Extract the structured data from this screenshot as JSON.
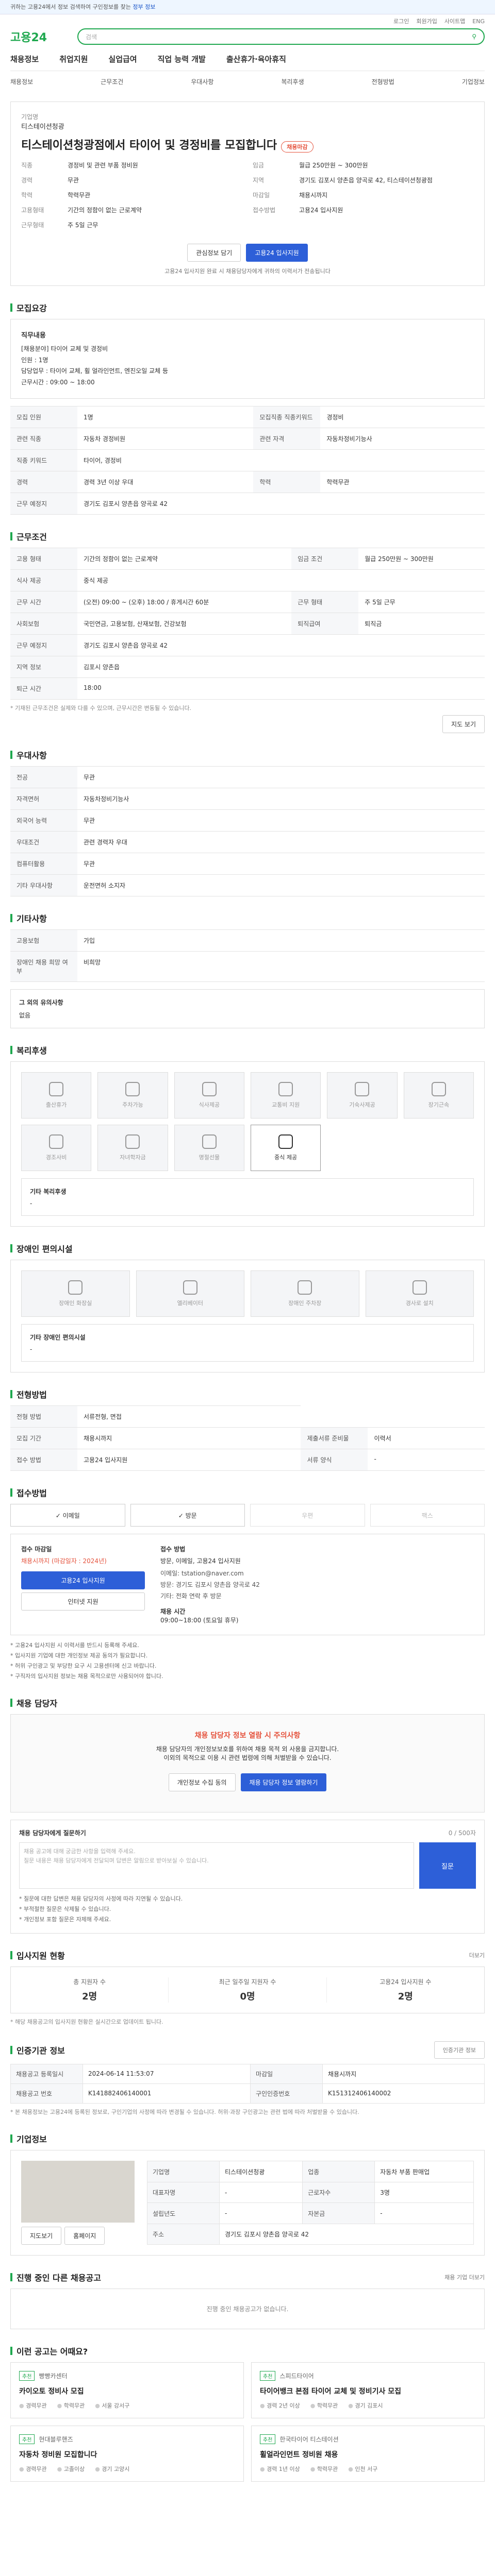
{
  "topbar": {
    "text": "귀하는 고용24에서 정보 검색하여 구인정보를 찾는",
    "link": "정부 정보"
  },
  "header": {
    "logo": "고용24",
    "search_placeholder": "검색",
    "util": [
      "로그인",
      "회원가입",
      "사이트맵",
      "ENG"
    ],
    "nav": [
      "채용정보",
      "취업지원",
      "실업급여",
      "직업 능력 개발",
      "출산휴가·육아휴직"
    ],
    "sub": [
      "채용정보",
      "근무조건",
      "우대사항",
      "복리후생",
      "전형방법",
      "기업정보"
    ]
  },
  "job": {
    "company_label": "기업명",
    "company": "티스테이션청광",
    "title": "티스테이션청광점에서 타이어 및 경정비를 모집합니다",
    "badge": "채용마감",
    "left": [
      [
        "직종",
        "경정비 및 관련 부품 정비원"
      ],
      [
        "경력",
        "무관"
      ],
      [
        "학력",
        "학력무관"
      ],
      [
        "고용형태",
        "기간의 정함이 없는 근로계약"
      ],
      [
        "근무형태",
        "주 5일 근무"
      ]
    ],
    "right": [
      [
        "임금",
        "월급 250만원 ~ 300만원"
      ],
      [
        "지역",
        "경기도 김포시 양촌읍 양곡로 42, 티스테이션청광점"
      ],
      [
        "마감일",
        "채용시까지"
      ],
      [
        "접수방법",
        "고용24 입사지원"
      ]
    ],
    "btn_scrap": "관심정보 담기",
    "btn_apply": "고용24 입사지원",
    "note": "고용24 입사지원 완료 시 채용담당자에게 귀하의 이력서가 전송됩니다"
  },
  "recruit": {
    "title": "모집요강",
    "desc_label": "직무내용",
    "desc": "[채용분야] 타이어 교체 및 경정비\n인원 : 1명\n담당업무 : 타이어 교체, 휠 얼라인먼트, 엔진오일 교체 등\n근무시간 : 09:00 ~ 18:00",
    "rows": [
      [
        "모집 인원",
        "1명",
        "모집직종 직종키워드",
        "경정비"
      ],
      [
        "관련 직종",
        "자동차 경정비원",
        "관련 자격",
        "자동차정비기능사"
      ],
      [
        "직종 키워드",
        "타이어, 경정비",
        "",
        ""
      ],
      [
        "경력",
        "경력 3년 이상 우대",
        "학력",
        "학력무관"
      ],
      [
        "근무 예정지",
        "경기도 김포시 양촌읍 양곡로 42",
        "",
        ""
      ]
    ]
  },
  "condition": {
    "title": "근무조건",
    "rows": [
      [
        "고용 형태",
        "기간의 정함이 없는 근로계약",
        "임금 조건",
        "월급 250만원 ~ 300만원"
      ],
      [
        "식사 제공",
        "중식 제공",
        "",
        ""
      ],
      [
        "근무 시간",
        "(오전) 09:00 ~ (오후) 18:00 / 휴게시간 60분",
        "근무 형태",
        "주 5일 근무"
      ],
      [
        "사회보험",
        "국민연금, 고용보험, 산재보험, 건강보험",
        "퇴직급여",
        "퇴직금"
      ],
      [
        "근무 예정지",
        "경기도 김포시 양촌읍 양곡로 42",
        "",
        ""
      ],
      [
        "지역 정보",
        "김포시 양촌읍",
        "",
        ""
      ],
      [
        "퇴근 시간",
        "18:00",
        "",
        ""
      ]
    ],
    "note": "* 기재된 근무조건은 실제와 다를 수 있으며, 근무시간은 변동될 수 있습니다.",
    "btn_map": "지도 보기"
  },
  "preference": {
    "title": "우대사항",
    "rows": [
      [
        "전공",
        "무관"
      ],
      [
        "자격면허",
        "자동차정비기능사"
      ],
      [
        "외국어 능력",
        "무관"
      ],
      [
        "우대조건",
        "관련 경력자 우대"
      ],
      [
        "컴퓨터활용",
        "무관"
      ],
      [
        "기타 우대사항",
        "운전면허 소지자"
      ]
    ]
  },
  "other": {
    "title": "기타사항",
    "rows": [
      [
        "고용보험",
        "가입"
      ],
      [
        "장애인 채용 희망 여부",
        "비희망"
      ]
    ],
    "extra_label": "그 외의 유의사항",
    "extra": "없음"
  },
  "welfare": {
    "title": "복리후생",
    "tiles": [
      {
        "label": "출산휴가",
        "on": false
      },
      {
        "label": "주차가능",
        "on": false
      },
      {
        "label": "식사제공",
        "on": false
      },
      {
        "label": "교통비 지원",
        "on": false
      },
      {
        "label": "기숙사제공",
        "on": false
      },
      {
        "label": "장기근속",
        "on": false
      },
      {
        "label": "경조사비",
        "on": false
      },
      {
        "label": "자녀학자금",
        "on": false
      },
      {
        "label": "명절선물",
        "on": false
      },
      {
        "label": "중식 제공",
        "on": true
      }
    ],
    "box_title": "기타 복리후생",
    "box_val": "-"
  },
  "disabled": {
    "title": "장애인 편의시설",
    "tiles": [
      "장애인 화장실",
      "엘리베이터",
      "장애인 주차장",
      "경사로 설치"
    ],
    "box_title": "기타 장애인 편의시설",
    "box_val": "-"
  },
  "process": {
    "title": "전형방법",
    "rows": [
      [
        "전형 방법",
        "서류전형, 면접"
      ],
      [
        "모집 기간",
        "채용시까지",
        "제출서류 준비물",
        "이력서"
      ],
      [
        "접수 방법",
        "고용24 입사지원",
        "서류 양식",
        "-"
      ]
    ]
  },
  "apply": {
    "title": "접수방법",
    "methods": [
      {
        "label": "이메일",
        "on": true
      },
      {
        "label": "방문",
        "on": true
      },
      {
        "label": "우편",
        "on": false
      },
      {
        "label": "팩스",
        "on": false
      }
    ],
    "deadline_label": "접수 마감일",
    "deadline": "채용시까지 (마감일자 : 2024년)",
    "btn_apply": "고용24 입사지원",
    "btn_map": "인터넷 지원",
    "dept_label": "접수 방법",
    "dept": "방문, 이메일, 고용24 입사지원",
    "detail": "이메일: tstation@naver.com\n방문: 경기도 김포시 양촌읍 양곡로 42\n기타: 전화 연락 후 방문",
    "hours_label": "채용 시간",
    "hours": "09:00~18:00 (토요일 휴무)",
    "bullets": [
      "* 고용24 입사지원 시 이력서를 반드시 등록해 주세요.",
      "* 입사지원 기업에 대한 개인정보 제공 동의가 필요합니다.",
      "* 허위 구인광고 및 부당한 요구 시 고용센터에 신고 바랍니다.",
      "* 구직자의 입사지원 정보는 채용 목적으로만 사용되어야 합니다."
    ]
  },
  "manager": {
    "title": "채용 담당자",
    "warn": "채용 담당자 정보 열람 시 주의사항",
    "text1": "채용 담당자의 개인정보보호를 위하여 채용 목적 외 사용을 금지합니다.",
    "text2": "이외의 목적으로 이용 시 관련 법령에 의해 처벌받을 수 있습니다.",
    "btn1": "개인정보 수집 동의",
    "btn2": "채용 담당자 정보 열람하기",
    "q_title": "채용 담당자에게 질문하기",
    "q_count": "0 / 500자",
    "q_placeholder": "채용 공고에 대해 궁금한 사항을 입력해 주세요.\n질문 내용은 채용 담당자에게 전달되며 답변은 알림으로 받아보실 수 있습니다.",
    "q_btn": "질문",
    "q_notes": [
      "* 질문에 대한 답변은 채용 담당자의 사정에 따라 지연될 수 있습니다.",
      "* 부적절한 질문은 삭제될 수 있습니다.",
      "* 개인정보 포함 질문은 자제해 주세요."
    ]
  },
  "status": {
    "title": "입사지원 현황",
    "stats": [
      {
        "label": "총 지원자 수",
        "n": "2명"
      },
      {
        "label": "최근 일주일 지원자 수",
        "n": "0명"
      },
      {
        "label": "고용24 입사지원 수",
        "n": "2명"
      }
    ],
    "note": "* 해당 채용공고의 입사지원 현황은 실시간으로 업데이트 됩니다.",
    "btn": "더보기"
  },
  "info": {
    "title": "인증기관 정보",
    "btn": "인증기관 정보",
    "rows": [
      [
        "채용공고 등록일시",
        "2024-06-14 11:53:07",
        "마감일",
        "채용시까지"
      ],
      [
        "채용공고 번호",
        "K141882406140001",
        "구인인증번호",
        "K151312406140002"
      ]
    ],
    "note": "* 본 채용정보는 고용24에 등록된 정보로, 구인기업의 사정에 따라 변경될 수 있습니다. 허위·과장 구인광고는 관련 법에 따라 처벌받을 수 있습니다."
  },
  "company": {
    "title": "기업정보",
    "rows": [
      [
        "기업명",
        "티스테이션청광",
        "업종",
        "자동차 부품 판매업"
      ],
      [
        "대표자명",
        "-",
        "근로자수",
        "3명"
      ],
      [
        "설립년도",
        "-",
        "자본금",
        "-"
      ],
      [
        "주소",
        "경기도 김포시 양촌읍 양곡로 42",
        "",
        ""
      ]
    ],
    "btn1": "지도보기",
    "btn2": "홈페이지"
  },
  "otherjobs": {
    "title": "진행 중인 다른 채용공고",
    "empty": "진행 중인 채용공고가 없습니다.",
    "more": "채용 기업 더보기"
  },
  "recs": {
    "title": "이런 공고는 어때요?",
    "items": [
      {
        "co": "빵빵카센터",
        "tag": "추천",
        "title": "카이오토 정비사 모집",
        "m": [
          "경력무관",
          "학력무관",
          "서울 강서구"
        ]
      },
      {
        "co": "스피드타이어",
        "tag": "추천",
        "title": "타이어뱅크 본점 타이어 교체 및 정비기사 모집",
        "m": [
          "경력 2년 이상",
          "학력무관",
          "경기 김포시"
        ]
      },
      {
        "co": "현대블루핸즈",
        "tag": "추천",
        "title": "자동차 정비원 모집합니다",
        "m": [
          "경력무관",
          "고졸이상",
          "경기 고양시"
        ]
      },
      {
        "co": "한국타이어 티스테이션",
        "tag": "추천",
        "title": "휠얼라인먼트 정비원 채용",
        "m": [
          "경력 1년 이상",
          "학력무관",
          "인천 서구"
        ]
      }
    ]
  }
}
